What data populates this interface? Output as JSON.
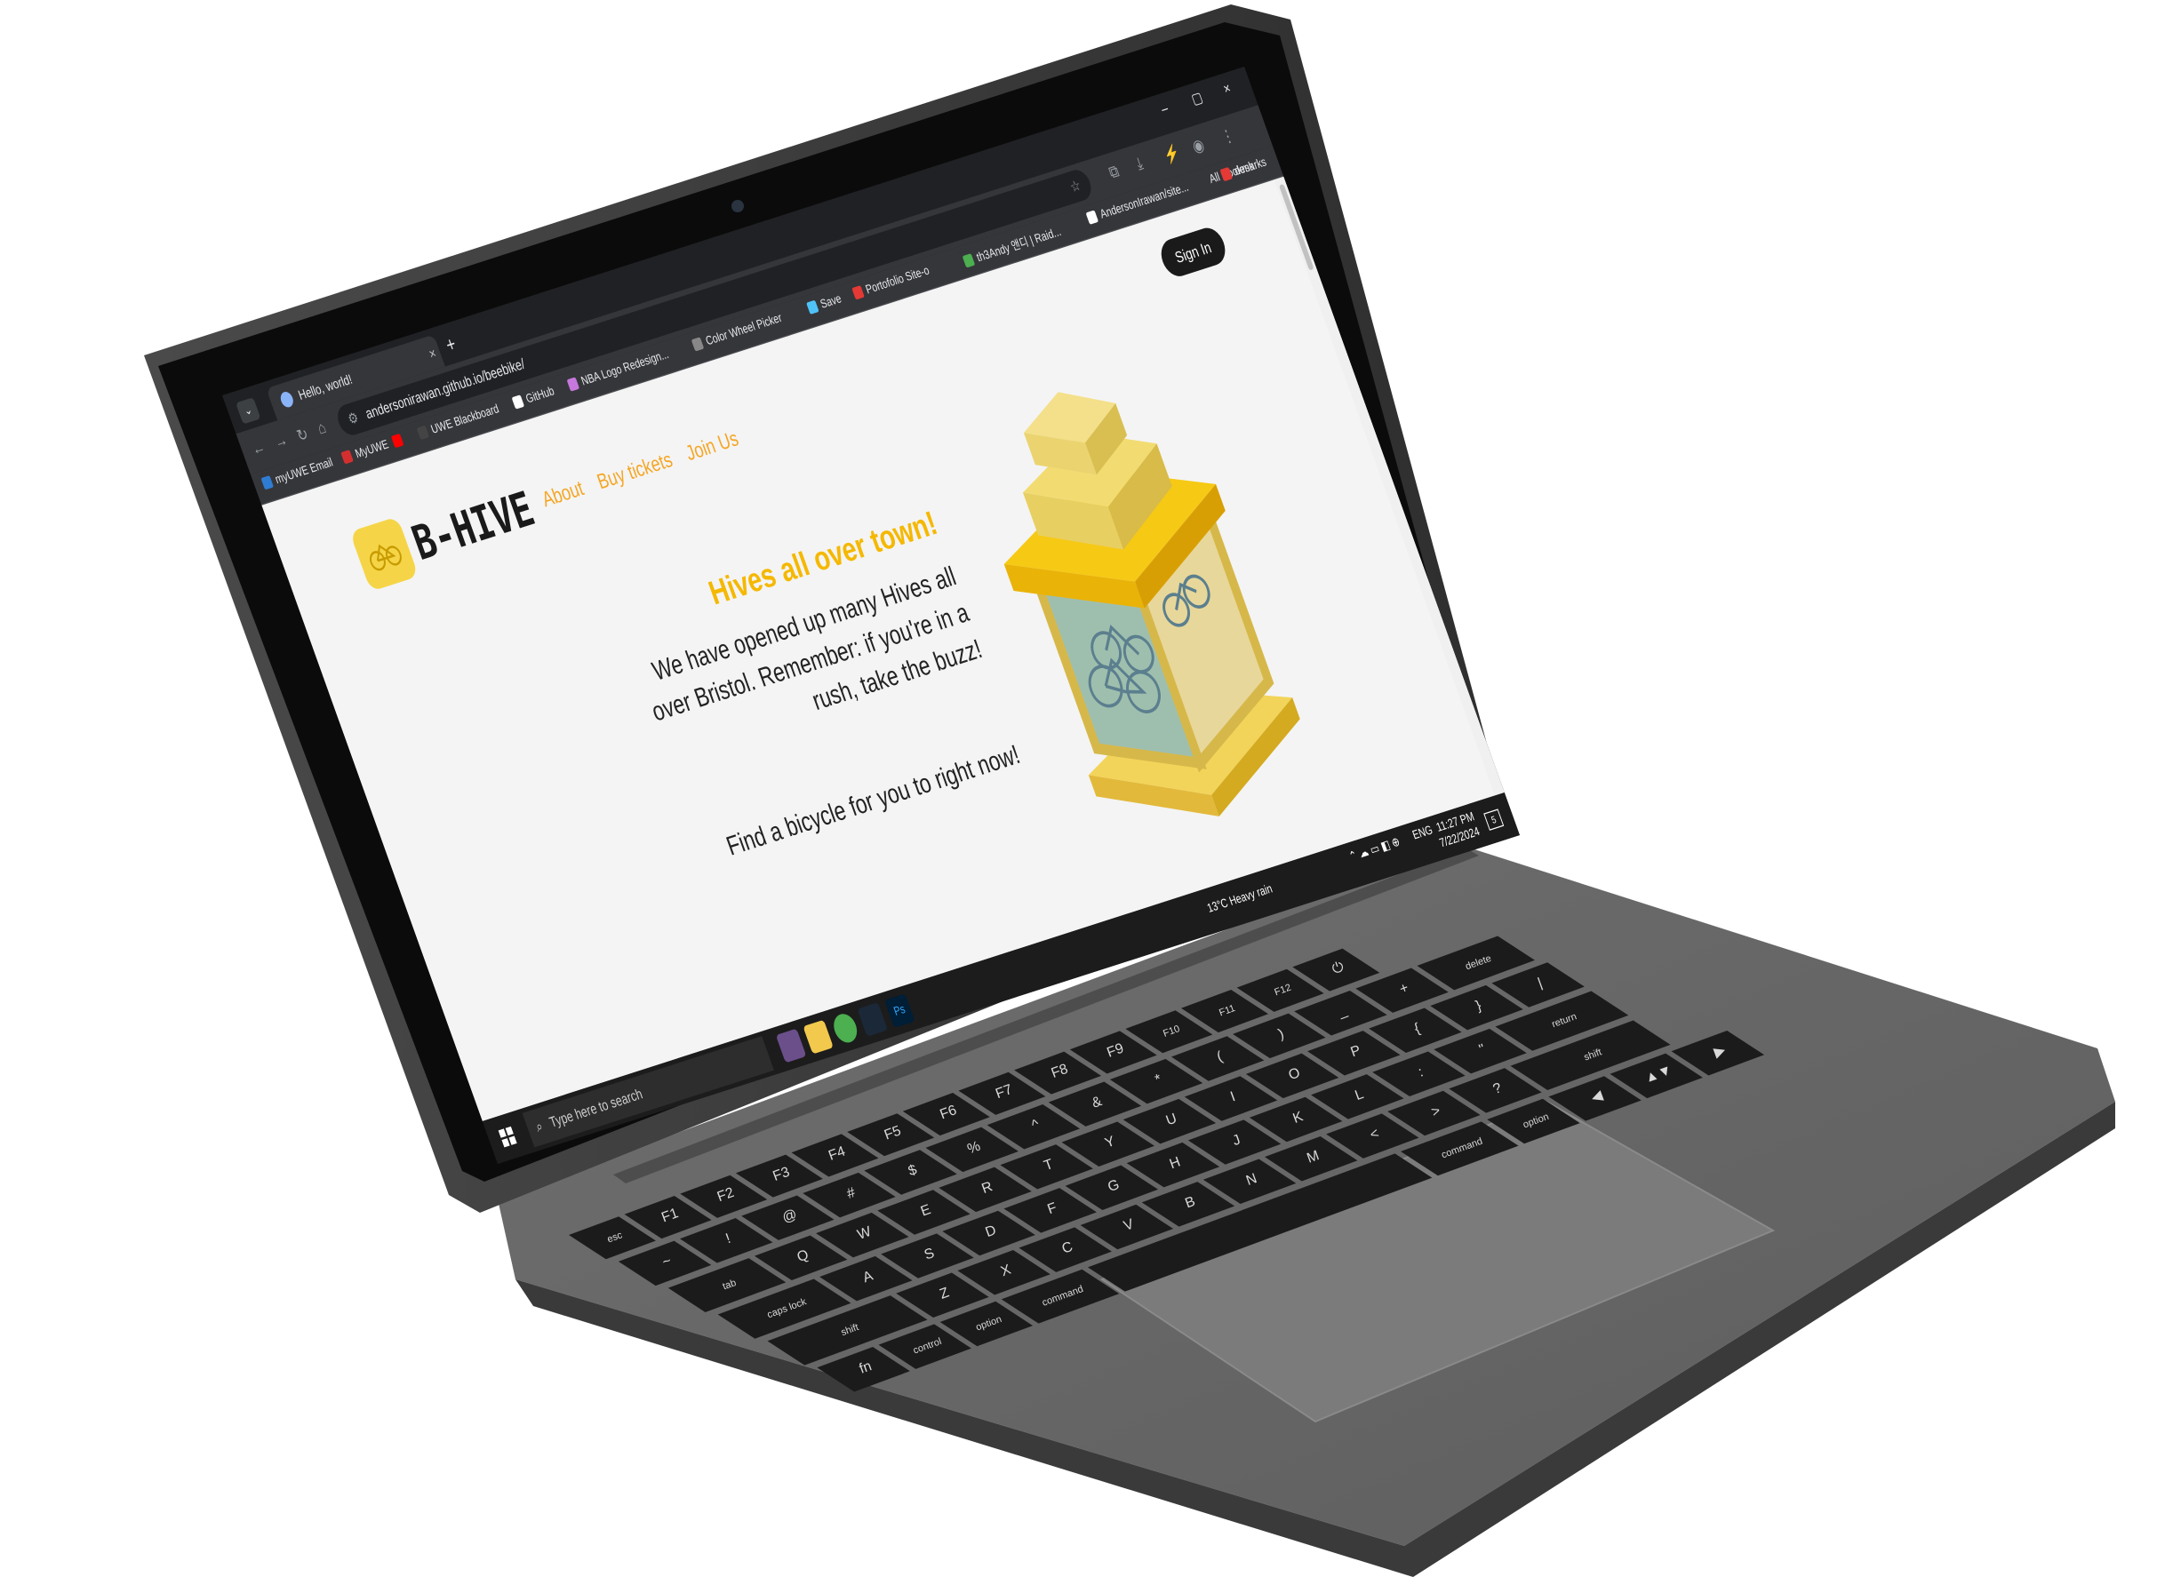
{
  "browser": {
    "tab_title": "Hello, world!",
    "tab_close": "×",
    "new_tab": "+",
    "url": "andersonirawan.github.io/beebike/",
    "window_controls": [
      "–",
      "▢",
      "×"
    ],
    "bookmarks": [
      {
        "label": "myUWE Email",
        "color": "#2f7cd3"
      },
      {
        "label": "MyUWE",
        "color": "#d32f2f"
      },
      {
        "label": "",
        "color": "#ff0000"
      },
      {
        "label": "UWE Blackboard",
        "color": "#444444"
      },
      {
        "label": "GitHub",
        "color": "#ffffff"
      },
      {
        "label": "NBA Logo Redesign...",
        "color": "#c678dd"
      },
      {
        "label": "Color Wheel Picker",
        "color": "#888888"
      },
      {
        "label": "Save",
        "color": "#4fc3f7"
      },
      {
        "label": "Portofolio Site-o",
        "color": "#e53935"
      },
      {
        "label": "th3Andy 앤디 | Raid...",
        "color": "#4caf50"
      },
      {
        "label": "AndersonIrawan/site...",
        "color": "#ffffff"
      },
      {
        "label": "desk",
        "color": "#e53935"
      }
    ],
    "all_bookmarks": "All Bookmarks"
  },
  "site": {
    "brand": "B-HIVE",
    "nav": [
      "About",
      "Buy tickets",
      "Join Us"
    ],
    "sign_in": "Sign In",
    "headline": "Hives all over town!",
    "body": "We have opened up many Hives all over Bristol. Remember: if you're in a rush, take the buzz!",
    "cta": "Find a bicycle for you to right now!",
    "colors": {
      "accent": "#f5b800",
      "nav": "#f5a623",
      "logo_bg": "#f5d547"
    }
  },
  "taskbar": {
    "search_placeholder": "Type here to search",
    "weather": "13°C  Heavy rain",
    "language": "ENG",
    "time": "11:27 PM",
    "date": "7/22/2024",
    "notifications": "5"
  },
  "keyboard": {
    "fn_row": [
      "esc",
      "F1",
      "F2",
      "F3",
      "F4",
      "F5",
      "F6",
      "F7",
      "F8",
      "F9",
      "F10",
      "F11",
      "F12",
      "⏻"
    ],
    "number_row": [
      "~",
      "!",
      "@",
      "#",
      "$",
      "%",
      "^",
      "&",
      "*",
      "(",
      ")",
      "_",
      "+",
      "delete"
    ],
    "top_row": [
      "tab",
      "Q",
      "W",
      "E",
      "R",
      "T",
      "Y",
      "U",
      "I",
      "O",
      "P",
      "{",
      "}",
      "|"
    ],
    "home_row": [
      "caps lock",
      "A",
      "S",
      "D",
      "F",
      "G",
      "H",
      "J",
      "K",
      "L",
      ":",
      "\"",
      "return"
    ],
    "bottom_row": [
      "shift",
      "Z",
      "X",
      "C",
      "V",
      "B",
      "N",
      "M",
      "<",
      ">",
      "?",
      "shift"
    ],
    "space_row": [
      "fn",
      "control",
      "option",
      "command",
      "",
      "command",
      "option",
      "◀",
      "▲▼",
      "▶"
    ]
  }
}
